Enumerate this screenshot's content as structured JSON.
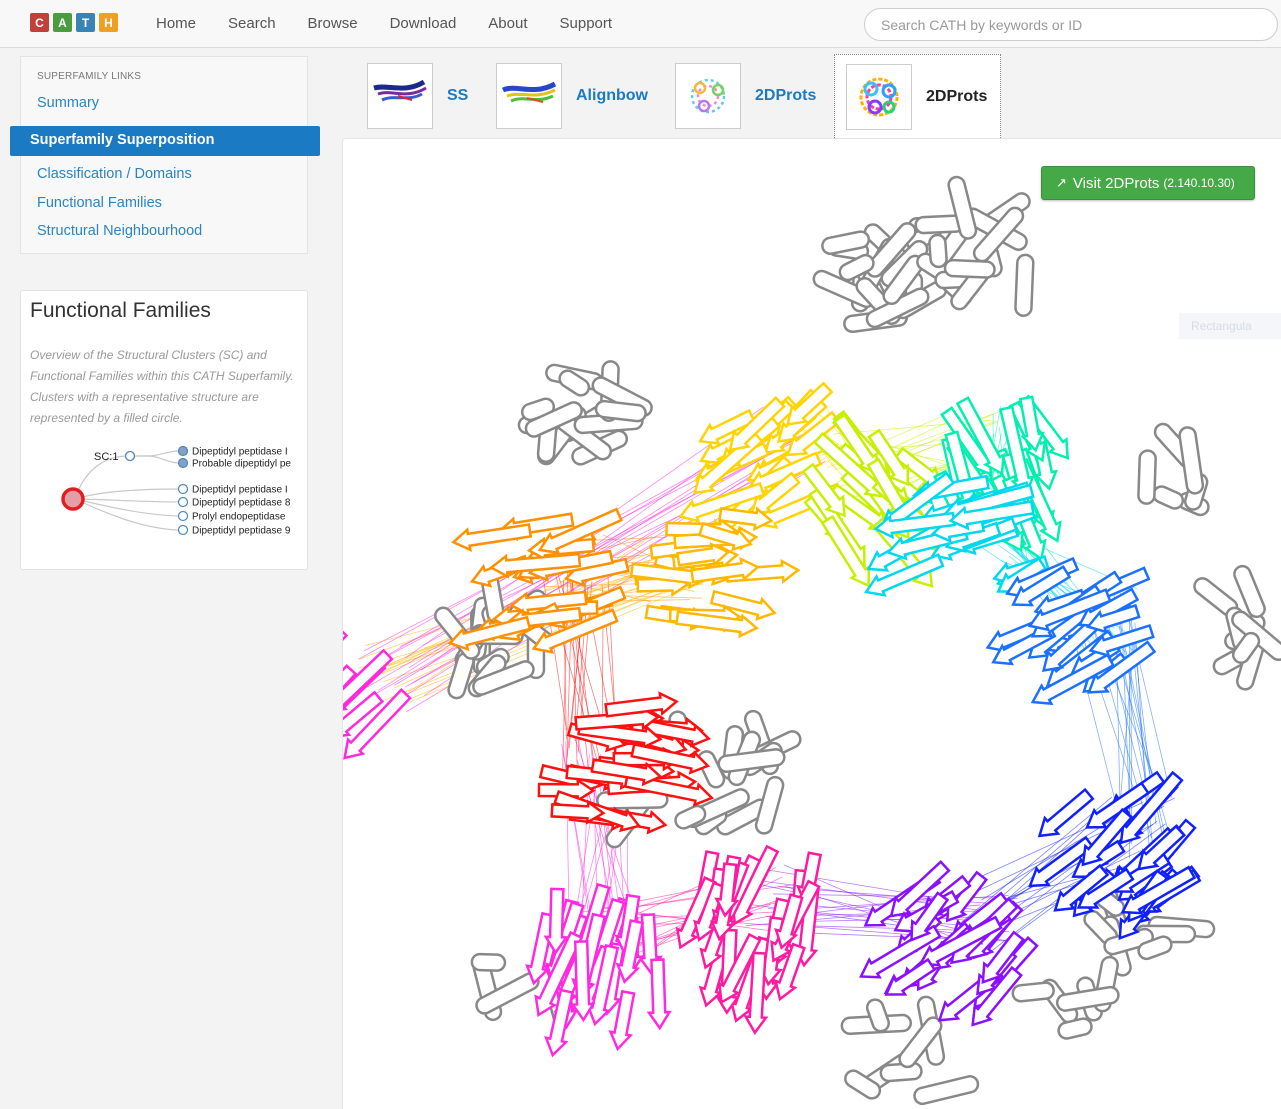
{
  "navbar": {
    "logo_letters": [
      {
        "letter": "C",
        "color": "#c1413a"
      },
      {
        "letter": "A",
        "color": "#4b9c3f"
      },
      {
        "letter": "T",
        "color": "#3a83b5"
      },
      {
        "letter": "H",
        "color": "#ef9f24"
      }
    ],
    "links": [
      "Home",
      "Search",
      "Browse",
      "Download",
      "About",
      "Support"
    ],
    "search_placeholder": "Search CATH by keywords or ID"
  },
  "sidebar": {
    "links_title": "SUPERFAMILY LINKS",
    "items": [
      "Summary",
      "Superfamily Superposition",
      "Classification / Domains",
      "Functional Families",
      "Structural Neighbourhood"
    ],
    "active_item": "Superfamily Superposition"
  },
  "functional_families": {
    "title": "Functional Families",
    "description": "Overview of the Structural Clusters (SC) and Functional Families within this CATH Superfamily. Clusters with a representative structure are represented by a filled circle.",
    "cluster_label": "SC:1",
    "families": [
      {
        "label": "Dipeptidyl peptidase I",
        "filled": true
      },
      {
        "label": "Probable dipeptidyl pe",
        "filled": true
      },
      {
        "label": "Dipeptidyl peptidase I",
        "filled": false
      },
      {
        "label": "Dipeptidyl peptidase 8",
        "filled": false
      },
      {
        "label": "Prolyl endopeptidase",
        "filled": false
      },
      {
        "label": "Dipeptidyl peptidase 9",
        "filled": false
      }
    ]
  },
  "tabs": [
    {
      "label": "SS",
      "active": false
    },
    {
      "label": "Alignbow",
      "active": false
    },
    {
      "label": "2DProts",
      "active": false
    },
    {
      "label": "2DProts",
      "active": true
    }
  ],
  "main": {
    "visit_button_label": "Visit 2DProts",
    "visit_button_id": "(2.140.10.30)",
    "ghost_label": "Rectangula"
  },
  "colors": {
    "accent": "#1a7ac4",
    "button_green": "#45a948",
    "alpha_helix": "#888888"
  }
}
